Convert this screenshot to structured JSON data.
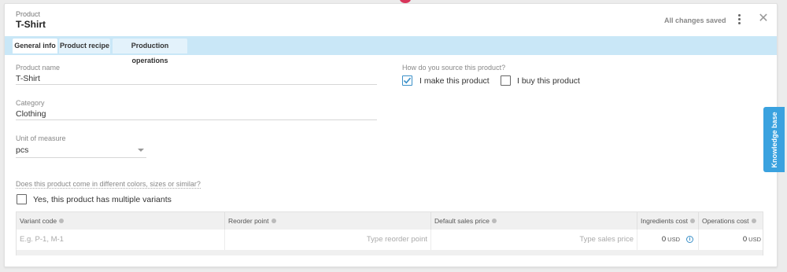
{
  "header": {
    "subtitle": "Product",
    "title": "T-Shirt",
    "status": "All changes saved"
  },
  "tabs": [
    {
      "label": "General info",
      "active": true
    },
    {
      "label": "Product recipe",
      "active": false
    },
    {
      "label": "Production operations",
      "active": false
    }
  ],
  "form": {
    "product_name_label": "Product name",
    "product_name_value": "T-Shirt",
    "category_label": "Category",
    "category_value": "Clothing",
    "uom_label": "Unit of measure",
    "uom_value": "pcs",
    "source_question": "How do you source this product?",
    "make_label": "I make this product",
    "make_checked": true,
    "buy_label": "I buy this product",
    "buy_checked": false,
    "variants_question": "Does this product come in different colors, sizes or similar?",
    "variants_label": "Yes, this product has multiple variants",
    "variants_checked": false
  },
  "knowledge_base": {
    "label": "Knowledge base"
  },
  "table": {
    "columns": [
      "Variant code",
      "Reorder point",
      "Default sales price",
      "Ingredients cost",
      "Operations cost"
    ],
    "row": {
      "variant_code_placeholder": "E.g. P-1, M-1",
      "reorder_point_placeholder": "Type reorder point",
      "sales_price_placeholder": "Type sales price",
      "ingredients_cost": "0",
      "ingredients_currency": "USD",
      "operations_cost": "0",
      "operations_currency": "USD"
    }
  },
  "colors": {
    "accent": "#3aa2df",
    "tabbar": "#c9e7f7"
  }
}
